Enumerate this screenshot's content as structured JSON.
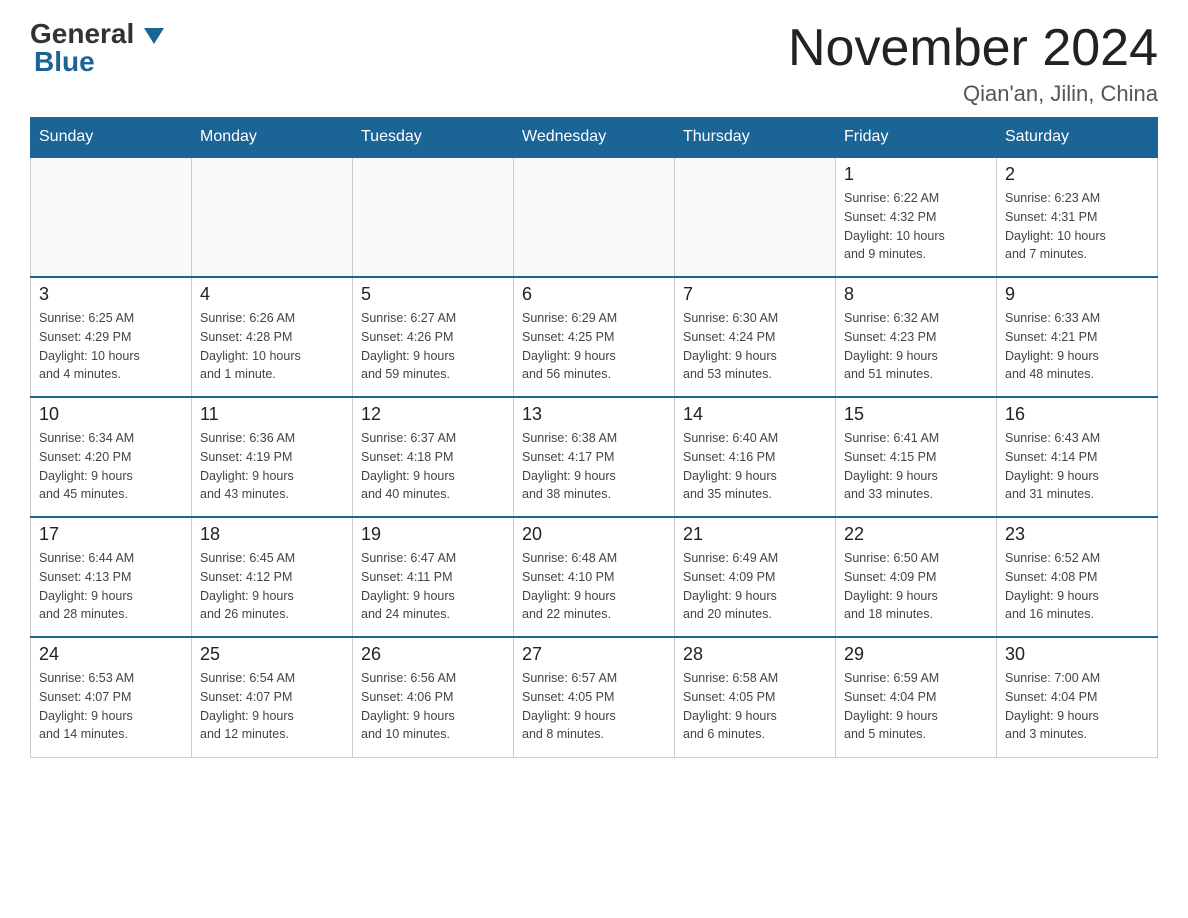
{
  "header": {
    "logo_general": "General",
    "logo_blue": "Blue",
    "month_title": "November 2024",
    "location": "Qian'an, Jilin, China"
  },
  "weekdays": [
    "Sunday",
    "Monday",
    "Tuesday",
    "Wednesday",
    "Thursday",
    "Friday",
    "Saturday"
  ],
  "weeks": [
    [
      {
        "day": "",
        "info": ""
      },
      {
        "day": "",
        "info": ""
      },
      {
        "day": "",
        "info": ""
      },
      {
        "day": "",
        "info": ""
      },
      {
        "day": "",
        "info": ""
      },
      {
        "day": "1",
        "info": "Sunrise: 6:22 AM\nSunset: 4:32 PM\nDaylight: 10 hours\nand 9 minutes."
      },
      {
        "day": "2",
        "info": "Sunrise: 6:23 AM\nSunset: 4:31 PM\nDaylight: 10 hours\nand 7 minutes."
      }
    ],
    [
      {
        "day": "3",
        "info": "Sunrise: 6:25 AM\nSunset: 4:29 PM\nDaylight: 10 hours\nand 4 minutes."
      },
      {
        "day": "4",
        "info": "Sunrise: 6:26 AM\nSunset: 4:28 PM\nDaylight: 10 hours\nand 1 minute."
      },
      {
        "day": "5",
        "info": "Sunrise: 6:27 AM\nSunset: 4:26 PM\nDaylight: 9 hours\nand 59 minutes."
      },
      {
        "day": "6",
        "info": "Sunrise: 6:29 AM\nSunset: 4:25 PM\nDaylight: 9 hours\nand 56 minutes."
      },
      {
        "day": "7",
        "info": "Sunrise: 6:30 AM\nSunset: 4:24 PM\nDaylight: 9 hours\nand 53 minutes."
      },
      {
        "day": "8",
        "info": "Sunrise: 6:32 AM\nSunset: 4:23 PM\nDaylight: 9 hours\nand 51 minutes."
      },
      {
        "day": "9",
        "info": "Sunrise: 6:33 AM\nSunset: 4:21 PM\nDaylight: 9 hours\nand 48 minutes."
      }
    ],
    [
      {
        "day": "10",
        "info": "Sunrise: 6:34 AM\nSunset: 4:20 PM\nDaylight: 9 hours\nand 45 minutes."
      },
      {
        "day": "11",
        "info": "Sunrise: 6:36 AM\nSunset: 4:19 PM\nDaylight: 9 hours\nand 43 minutes."
      },
      {
        "day": "12",
        "info": "Sunrise: 6:37 AM\nSunset: 4:18 PM\nDaylight: 9 hours\nand 40 minutes."
      },
      {
        "day": "13",
        "info": "Sunrise: 6:38 AM\nSunset: 4:17 PM\nDaylight: 9 hours\nand 38 minutes."
      },
      {
        "day": "14",
        "info": "Sunrise: 6:40 AM\nSunset: 4:16 PM\nDaylight: 9 hours\nand 35 minutes."
      },
      {
        "day": "15",
        "info": "Sunrise: 6:41 AM\nSunset: 4:15 PM\nDaylight: 9 hours\nand 33 minutes."
      },
      {
        "day": "16",
        "info": "Sunrise: 6:43 AM\nSunset: 4:14 PM\nDaylight: 9 hours\nand 31 minutes."
      }
    ],
    [
      {
        "day": "17",
        "info": "Sunrise: 6:44 AM\nSunset: 4:13 PM\nDaylight: 9 hours\nand 28 minutes."
      },
      {
        "day": "18",
        "info": "Sunrise: 6:45 AM\nSunset: 4:12 PM\nDaylight: 9 hours\nand 26 minutes."
      },
      {
        "day": "19",
        "info": "Sunrise: 6:47 AM\nSunset: 4:11 PM\nDaylight: 9 hours\nand 24 minutes."
      },
      {
        "day": "20",
        "info": "Sunrise: 6:48 AM\nSunset: 4:10 PM\nDaylight: 9 hours\nand 22 minutes."
      },
      {
        "day": "21",
        "info": "Sunrise: 6:49 AM\nSunset: 4:09 PM\nDaylight: 9 hours\nand 20 minutes."
      },
      {
        "day": "22",
        "info": "Sunrise: 6:50 AM\nSunset: 4:09 PM\nDaylight: 9 hours\nand 18 minutes."
      },
      {
        "day": "23",
        "info": "Sunrise: 6:52 AM\nSunset: 4:08 PM\nDaylight: 9 hours\nand 16 minutes."
      }
    ],
    [
      {
        "day": "24",
        "info": "Sunrise: 6:53 AM\nSunset: 4:07 PM\nDaylight: 9 hours\nand 14 minutes."
      },
      {
        "day": "25",
        "info": "Sunrise: 6:54 AM\nSunset: 4:07 PM\nDaylight: 9 hours\nand 12 minutes."
      },
      {
        "day": "26",
        "info": "Sunrise: 6:56 AM\nSunset: 4:06 PM\nDaylight: 9 hours\nand 10 minutes."
      },
      {
        "day": "27",
        "info": "Sunrise: 6:57 AM\nSunset: 4:05 PM\nDaylight: 9 hours\nand 8 minutes."
      },
      {
        "day": "28",
        "info": "Sunrise: 6:58 AM\nSunset: 4:05 PM\nDaylight: 9 hours\nand 6 minutes."
      },
      {
        "day": "29",
        "info": "Sunrise: 6:59 AM\nSunset: 4:04 PM\nDaylight: 9 hours\nand 5 minutes."
      },
      {
        "day": "30",
        "info": "Sunrise: 7:00 AM\nSunset: 4:04 PM\nDaylight: 9 hours\nand 3 minutes."
      }
    ]
  ]
}
